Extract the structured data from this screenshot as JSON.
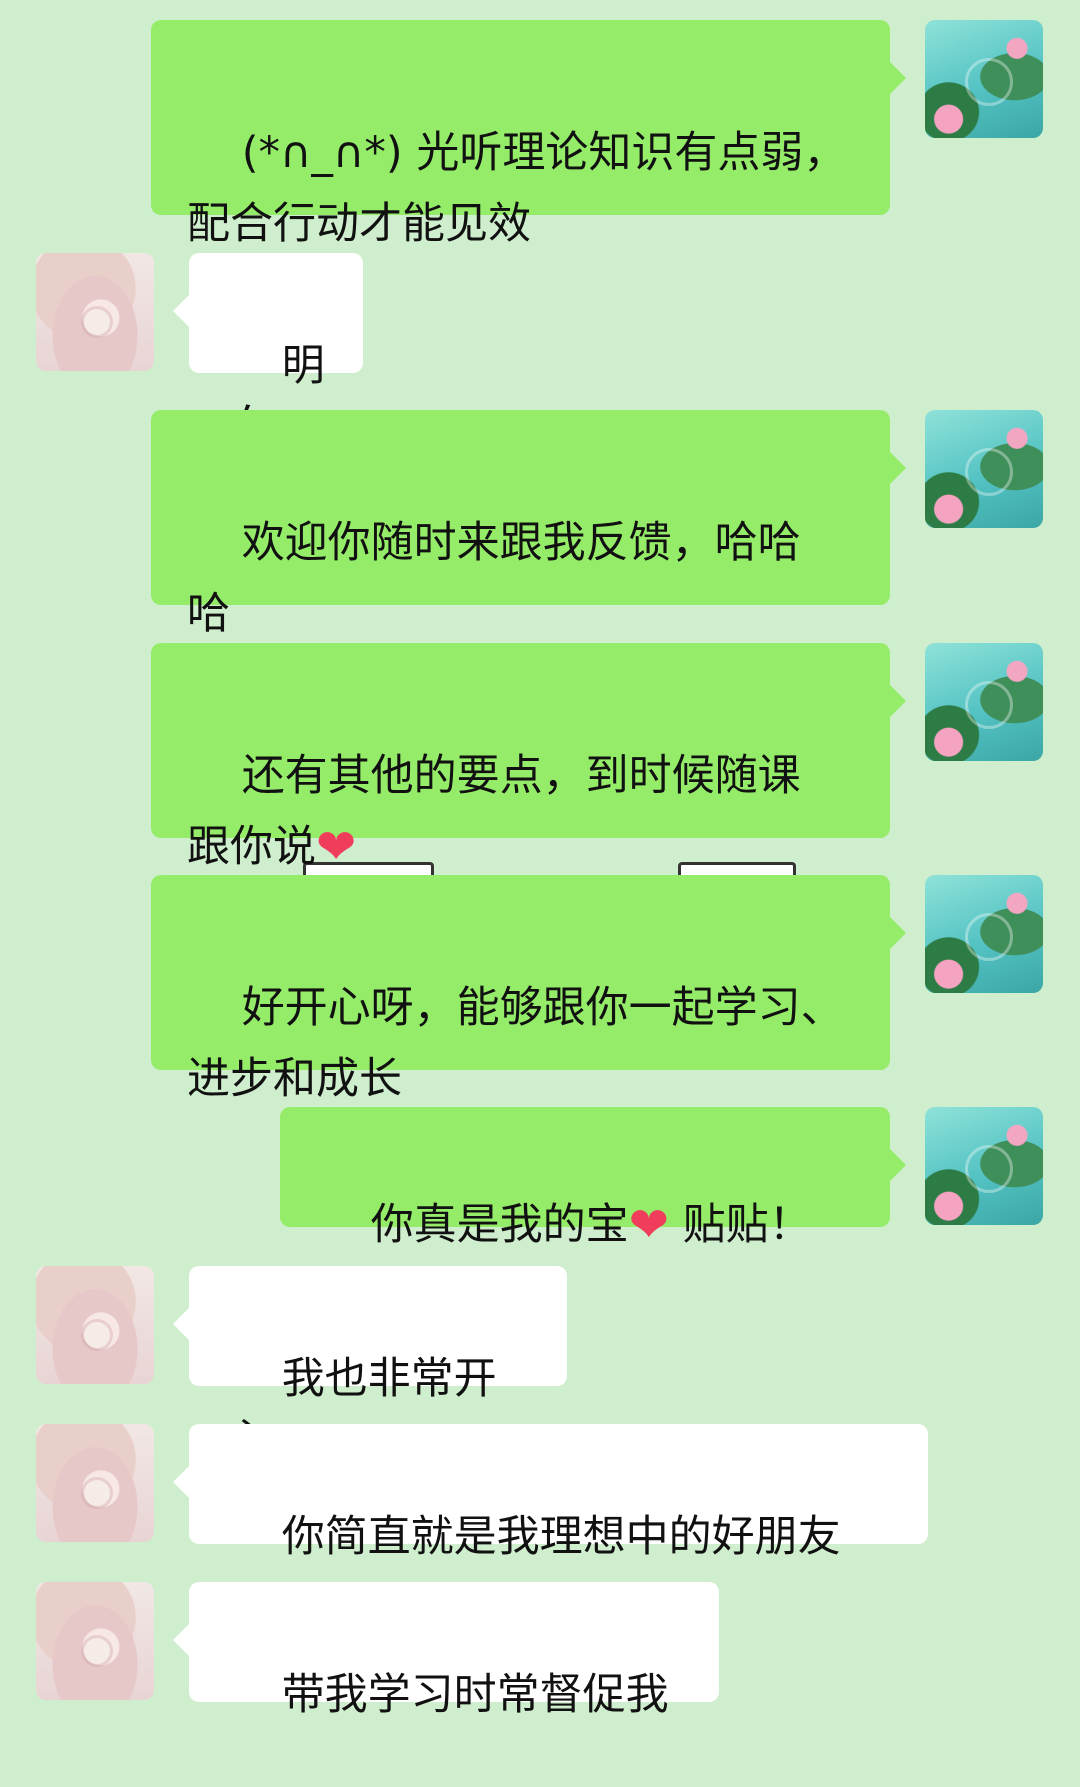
{
  "messages": [
    {
      "side": "self",
      "text": "(*∩_∩*) 光听理论知识有点弱，\n配合行动才能见效"
    },
    {
      "side": "other",
      "text": "明白"
    },
    {
      "side": "self",
      "text": "欢迎你随时来跟我反馈，哈哈\n哈"
    },
    {
      "side": "self",
      "text_before": "还有其他的要点，到时候随课\n跟你说",
      "heart": "❤",
      "text_after": ""
    },
    {
      "side": "self",
      "text": "好开心呀，能够跟你一起学习、\n进步和成长"
    },
    {
      "side": "self",
      "text_before": "你真是我的宝",
      "heart": "❤",
      "text_after": " 贴贴！"
    },
    {
      "side": "other",
      "text": "我也非常开心"
    },
    {
      "side": "other",
      "text": "你简直就是我理想中的好朋友"
    },
    {
      "side": "other",
      "text": "带我学习时常督促我"
    }
  ],
  "colors": {
    "background": "#cfeecd",
    "self_bubble": "#95ec69",
    "other_bubble": "#ffffff",
    "heart": "#f03d5b"
  },
  "icons": {
    "self_avatar": "lotus-pond-avatar",
    "other_avatar": "anime-girl-avatar",
    "heart": "heart-emoji"
  }
}
